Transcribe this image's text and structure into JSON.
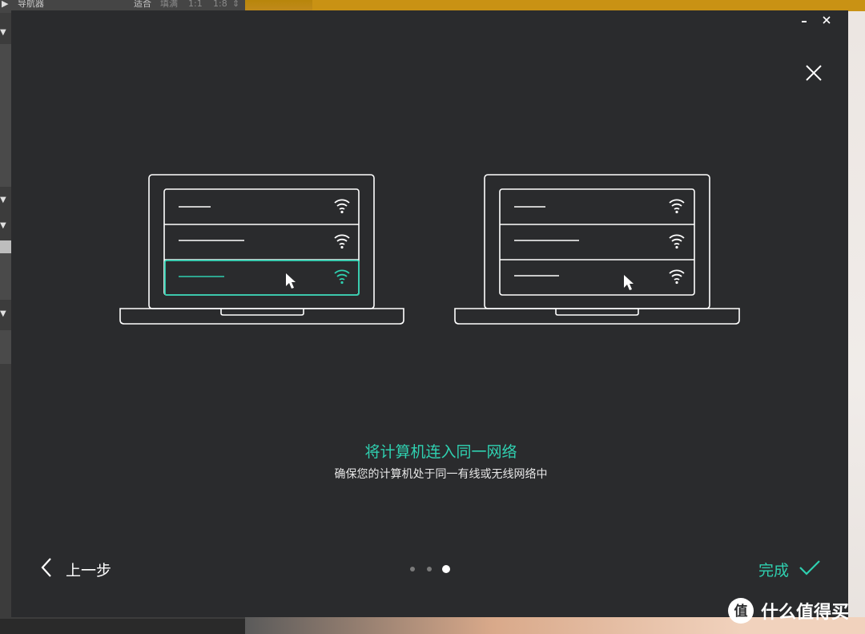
{
  "background_app": {
    "navigator_label": "导航器",
    "zoom_options": [
      "适合",
      "填满",
      "1:1",
      "1:8"
    ]
  },
  "modal": {
    "title": "将计算机连入同一网络",
    "subtitle": "确保您的计算机处于同一有线或无线网络中",
    "back_label": "上一步",
    "done_label": "完成",
    "pagination": {
      "total": 3,
      "active": 3
    }
  },
  "colors": {
    "accent": "#2fd0b0",
    "modal_bg": "#2a2b2d",
    "text": "#ffffff"
  },
  "icons": [
    "minimize-icon",
    "window-close-icon",
    "close-icon",
    "chevron-left-icon",
    "checkmark-icon",
    "wifi-icon",
    "cursor-icon",
    "laptop-illustration"
  ],
  "watermark": {
    "text": "什么值得买",
    "logo_char": "值"
  }
}
